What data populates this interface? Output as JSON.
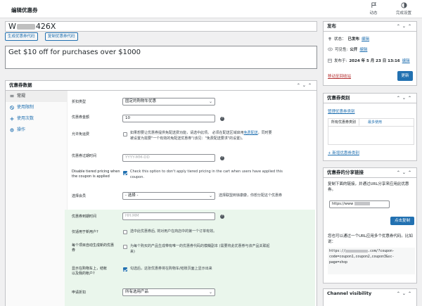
{
  "header": {
    "title": "编辑优惠券",
    "actions": [
      {
        "label": "动态",
        "icon": "flag-icon"
      },
      {
        "label": "完成设置",
        "icon": "progress-circle-icon"
      }
    ]
  },
  "coupon": {
    "code_prefix": "W",
    "code_suffix": "426X",
    "generate_label": "生成优惠券代码",
    "copy_label": "复制优惠券代码",
    "description": "Get $10 off for purchases over $1000"
  },
  "coupon_data": {
    "title": "优惠券数据",
    "tabs": [
      "常规",
      "使用限制",
      "使用次数",
      "操作"
    ],
    "fields": {
      "discount_type_label": "折扣类型",
      "discount_type_value": "固定的购物车优惠",
      "amount_label": "优惠券金额",
      "amount_value": "10",
      "free_shipping_label": "允许免运费",
      "free_shipping_note_1": "如果想要让优惠券提供免配送费功能，请选中此项。 必须在配送区域启用",
      "free_shipping_link": "免费配送",
      "free_shipping_note_2": "，同时要",
      "free_shipping_note_3": "被设置为需要\"一个有效的免配送优惠券\"(该见：\"免费配送要求\"的设置)。",
      "expiry_label": "优惠券过期时间",
      "expiry_placeholder": "YYYY-MM-DD",
      "tiered_label_1": "Disable tiered pricing when",
      "tiered_label_2": "the coupon is applied",
      "tiered_note_1": "Check this option to don't apply tiered pricing in the cart when users have applied this",
      "tiered_note_2": "coupon.",
      "member_label": "选择会员",
      "member_value": "- 选择 -",
      "member_note": "选择联盟到徐康康，你想分配这个优惠券",
      "expiry_time_label": "优惠券到期时间",
      "expiry_time_placeholder": "HH:MM",
      "new_user_label": "仅适用于新用户?",
      "new_user_note": "选中此优惠券后, 将对用户在商店中的第一个订单有效。",
      "auto_gen_label_1": "每个项目自动生成新的优惠",
      "auto_gen_label_2": "券",
      "auto_gen_note": "为每个购买的产品生成带有唯一的优惠券代码的模糊副本 (需要将此优惠券与该产品关联起",
      "auto_gen_note_2": "来)",
      "show_cart_label_1": "显示在购物车上，结帐",
      "show_cart_label_2": "以及我的帐户?",
      "show_cart_note": "勾选后，这张优惠券将在购物车/结账页面上显示出来",
      "apply_discount_label": "申请折扣",
      "apply_discount_value": "所有选用产品"
    }
  },
  "publish": {
    "title": "发布",
    "status_label": "状态：",
    "status_value": "已发布",
    "visibility_label": "可见性:",
    "visibility_value": "公开",
    "published_label": "发布于:",
    "published_value": "2024 年 5 月 23 日 13:16",
    "edit_label": "编辑",
    "trash_label": "移动至回收站",
    "update_label": "更新"
  },
  "categories": {
    "title": "优惠券类别",
    "manage_label": "管理优惠券类别",
    "tab_all": "所有优惠券类别",
    "tab_popular": "最多使用",
    "add_new_label": "+ 新增优惠券类别"
  },
  "share": {
    "title": "优惠券的分享链接",
    "description": "复制下面的链接，并通过URL分享来应用此优惠券。",
    "url_value": "https://www",
    "copy_button": "点击复制",
    "hint": "您也可以通过一个URL应用多个优惠券代码。比如说：",
    "example_1": "https://",
    "example_2": ".com/?coupon-",
    "example_3": "code=coupon1,coupon2,coupon3&sc-",
    "example_4": "page=shop"
  },
  "channel": {
    "title": "Channel visibility"
  },
  "colors": {
    "accent": "#2271b1",
    "danger": "#b32d2e",
    "highlight": "#eaf6ec"
  }
}
